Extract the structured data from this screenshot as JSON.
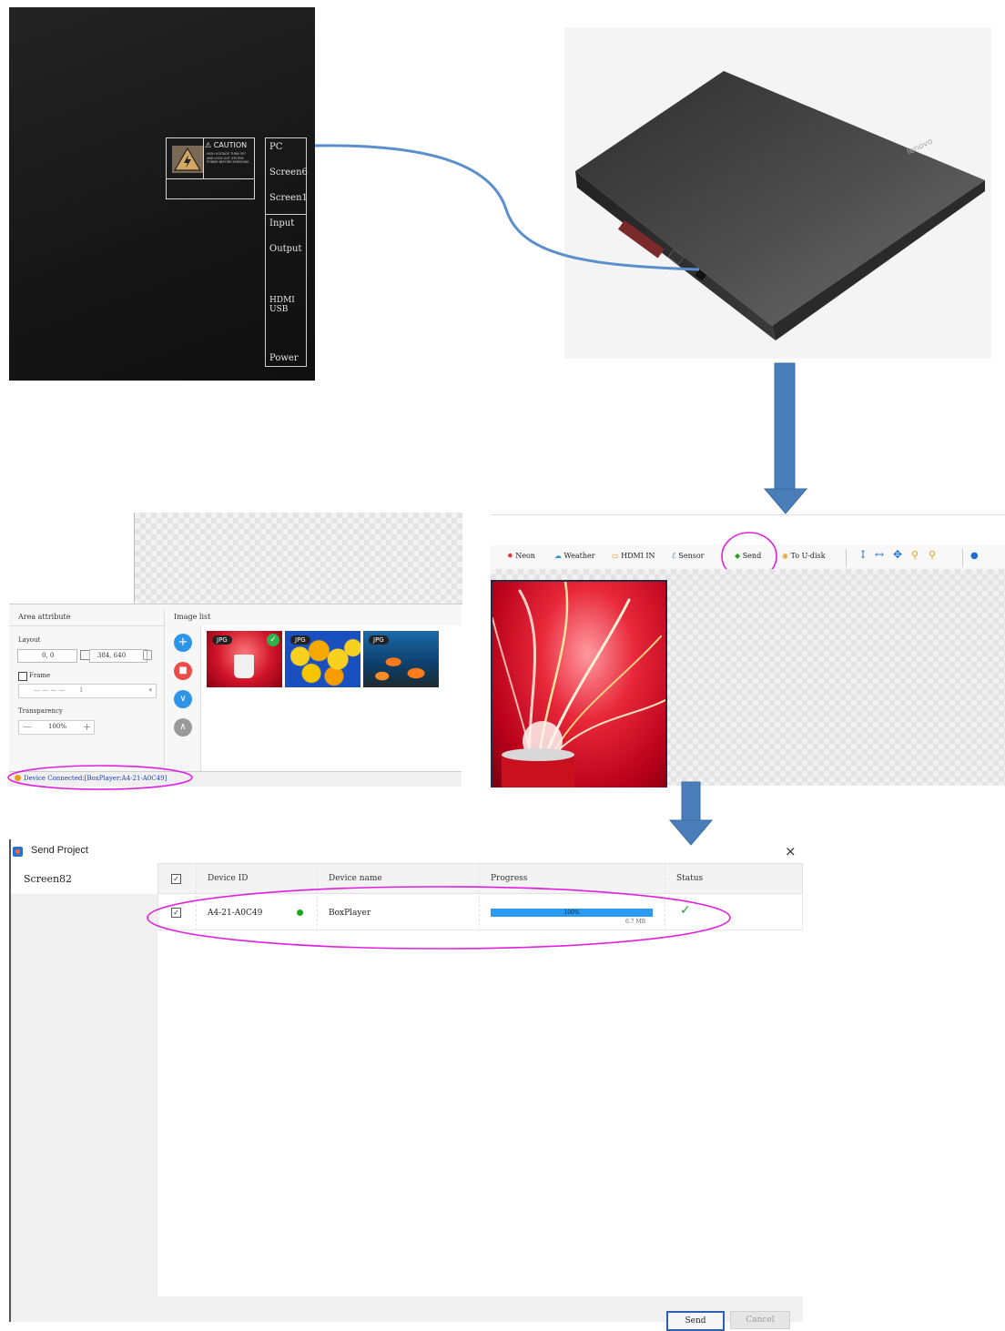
{
  "box": {
    "caution_label": "CAUTION",
    "caution_text": "HIGH VOLTAGE TURN OFF AND LOCK OUT SYSTEM POWER BEFORE SERVICING",
    "ports": [
      "PC",
      "Screen6",
      "Screen1",
      "Input",
      "Output",
      "HDMI USB",
      "Power"
    ]
  },
  "laptop": {
    "brand": "lenovo"
  },
  "editor": {
    "area_attribute": {
      "title": "Area attribute",
      "layout_label": "Layout",
      "position_value": "0, 0",
      "size_value": "384, 640",
      "frame_label": "Frame",
      "frame_value": "1",
      "transparency_label": "Transparency",
      "transparency_value": "100%"
    },
    "image_list": {
      "title": "Image list",
      "images": [
        {
          "tag": "JPG",
          "subject": "red cup",
          "selected": true
        },
        {
          "tag": "JPG",
          "subject": "lemon slices",
          "selected": false
        },
        {
          "tag": "JPG",
          "subject": "clownfish",
          "selected": false
        }
      ]
    },
    "status_bar": "Device Connected:[BoxPlayer:A4-21-A0C49]"
  },
  "toolbar": {
    "items": [
      "Neon",
      "Weather",
      "HDMI IN",
      "Sensor",
      "Send",
      "To U-disk"
    ]
  },
  "send_dialog": {
    "title": "Send Project",
    "close_glyph": "×",
    "screens": [
      "Screen82"
    ],
    "columns": [
      "Device ID",
      "Device name",
      "Progress",
      "Status"
    ],
    "rows": [
      {
        "device_id": "A4-21-A0C49",
        "device_name": "BoxPlayer",
        "progress": 100,
        "progress_label": "100%",
        "size": "6.7 MB",
        "status_glyph": "✓",
        "online": true,
        "checked": true
      }
    ],
    "send_label": "Send",
    "cancel_label": "Cancel"
  },
  "colors": {
    "highlight_ellipse": "#e020e0",
    "arrow": "#4a7ebb",
    "progress_fill": "#2b9af3",
    "online_dot": "#18a818",
    "status_ok": "#1aa034"
  }
}
